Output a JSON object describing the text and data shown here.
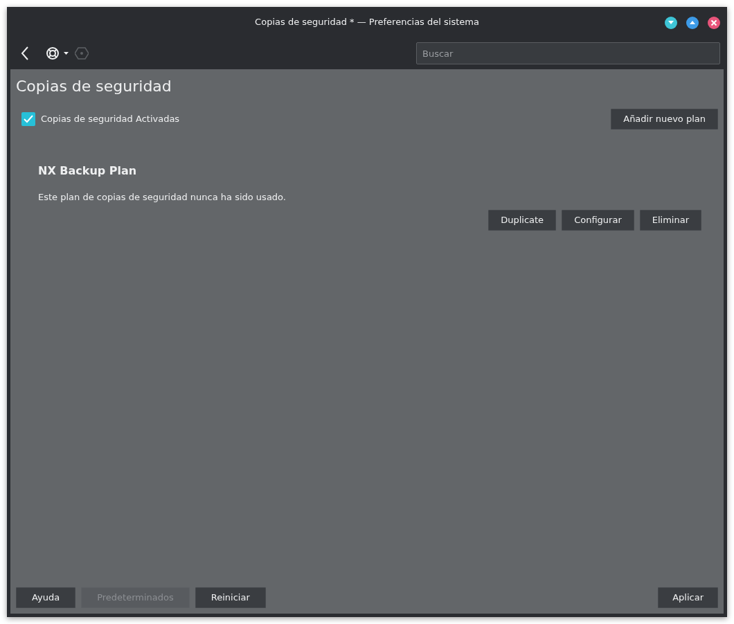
{
  "window": {
    "title": "Copias de seguridad * — Preferencias del sistema"
  },
  "window_controls": [
    {
      "kind": "minimize",
      "color": "#3ec5d6"
    },
    {
      "kind": "maximize",
      "color": "#3d9be8"
    },
    {
      "kind": "close",
      "color": "#e8547a"
    }
  ],
  "search": {
    "placeholder": "Buscar"
  },
  "page_title": "Copias de seguridad",
  "backups_enabled": {
    "label": "Copias de seguridad Activadas",
    "checked": true
  },
  "add_plan_button": "Añadir nuevo plan",
  "plans": [
    {
      "name": "NX Backup Plan",
      "status": "Este plan de copias de seguridad nunca ha sido usado.",
      "buttons": [
        "Duplicate",
        "Configurar",
        "Eliminar"
      ]
    }
  ],
  "footer_buttons": [
    {
      "label": "Ayuda",
      "disabled": false
    },
    {
      "label": "Predeterminados",
      "disabled": true
    },
    {
      "label": "Reiniciar",
      "disabled": false
    }
  ],
  "apply_button": {
    "label": "Aplicar",
    "disabled": false
  }
}
